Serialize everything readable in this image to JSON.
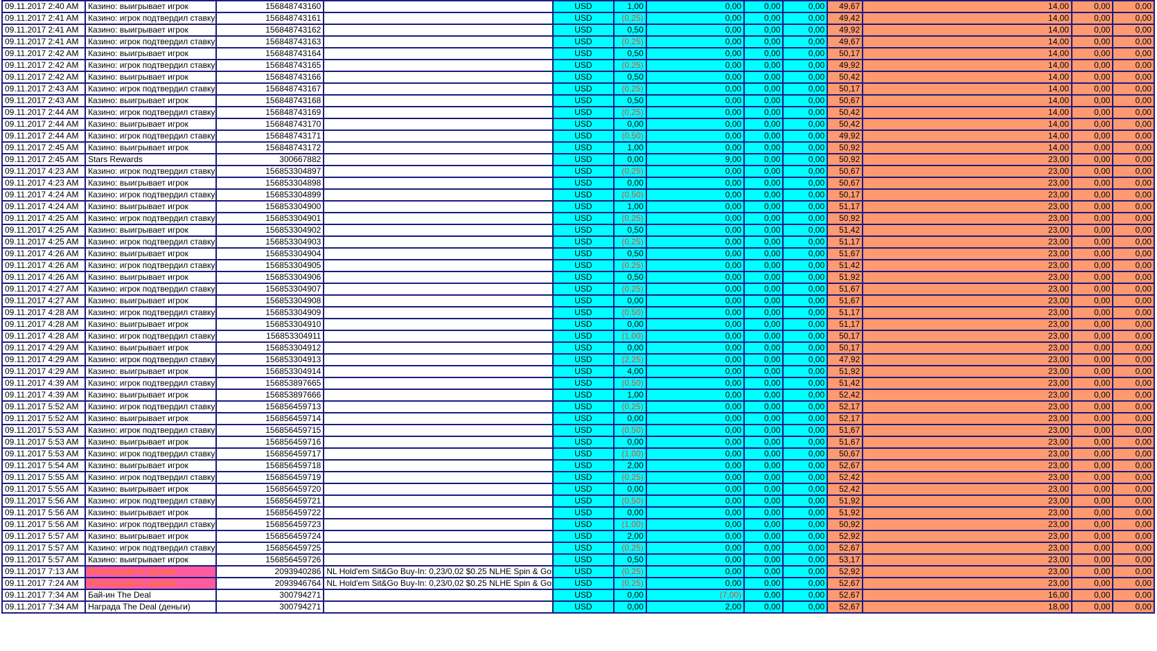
{
  "colors": {
    "border": "#1a1a80",
    "cyan": "#00ffff",
    "salmon": "#ff9a70",
    "pink": "#ff5ca0",
    "negative_text": "#e8452a"
  },
  "rows": [
    [
      "09.11.2017 2:40 AM",
      "Казино: выигрывает игрок",
      "156848743160",
      "",
      "USD",
      "1,00",
      "0,00",
      "0,00",
      "0,00",
      "49,67",
      "14,00",
      "0,00",
      "0,00"
    ],
    [
      "09.11.2017 2:41 AM",
      "Казино: игрок подтвердил ставку",
      "156848743161",
      "",
      "USD",
      "(0,25)",
      "0,00",
      "0,00",
      "0,00",
      "49,42",
      "14,00",
      "0,00",
      "0,00"
    ],
    [
      "09.11.2017 2:41 AM",
      "Казино: выигрывает игрок",
      "156848743162",
      "",
      "USD",
      "0,50",
      "0,00",
      "0,00",
      "0,00",
      "49,92",
      "14,00",
      "0,00",
      "0,00"
    ],
    [
      "09.11.2017 2:41 AM",
      "Казино: игрок подтвердил ставку",
      "156848743163",
      "",
      "USD",
      "(0,25)",
      "0,00",
      "0,00",
      "0,00",
      "49,67",
      "14,00",
      "0,00",
      "0,00"
    ],
    [
      "09.11.2017 2:42 AM",
      "Казино: выигрывает игрок",
      "156848743164",
      "",
      "USD",
      "0,50",
      "0,00",
      "0,00",
      "0,00",
      "50,17",
      "14,00",
      "0,00",
      "0,00"
    ],
    [
      "09.11.2017 2:42 AM",
      "Казино: игрок подтвердил ставку",
      "156848743165",
      "",
      "USD",
      "(0,25)",
      "0,00",
      "0,00",
      "0,00",
      "49,92",
      "14,00",
      "0,00",
      "0,00"
    ],
    [
      "09.11.2017 2:42 AM",
      "Казино: выигрывает игрок",
      "156848743166",
      "",
      "USD",
      "0,50",
      "0,00",
      "0,00",
      "0,00",
      "50,42",
      "14,00",
      "0,00",
      "0,00"
    ],
    [
      "09.11.2017 2:43 AM",
      "Казино: игрок подтвердил ставку",
      "156848743167",
      "",
      "USD",
      "(0,25)",
      "0,00",
      "0,00",
      "0,00",
      "50,17",
      "14,00",
      "0,00",
      "0,00"
    ],
    [
      "09.11.2017 2:43 AM",
      "Казино: выигрывает игрок",
      "156848743168",
      "",
      "USD",
      "0,50",
      "0,00",
      "0,00",
      "0,00",
      "50,67",
      "14,00",
      "0,00",
      "0,00"
    ],
    [
      "09.11.2017 2:44 AM",
      "Казино: игрок подтвердил ставку",
      "156848743169",
      "",
      "USD",
      "(0,25)",
      "0,00",
      "0,00",
      "0,00",
      "50,42",
      "14,00",
      "0,00",
      "0,00"
    ],
    [
      "09.11.2017 2:44 AM",
      "Казино: выигрывает игрок",
      "156848743170",
      "",
      "USD",
      "0,00",
      "0,00",
      "0,00",
      "0,00",
      "50,42",
      "14,00",
      "0,00",
      "0,00"
    ],
    [
      "09.11.2017 2:44 AM",
      "Казино: игрок подтвердил ставку",
      "156848743171",
      "",
      "USD",
      "(0,50)",
      "0,00",
      "0,00",
      "0,00",
      "49,92",
      "14,00",
      "0,00",
      "0,00"
    ],
    [
      "09.11.2017 2:45 AM",
      "Казино: выигрывает игрок",
      "156848743172",
      "",
      "USD",
      "1,00",
      "0,00",
      "0,00",
      "0,00",
      "50,92",
      "14,00",
      "0,00",
      "0,00"
    ],
    [
      "09.11.2017 2:45 AM",
      "Stars Rewards",
      "300667882",
      "",
      "USD",
      "0,00",
      "9,00",
      "0,00",
      "0,00",
      "50,92",
      "23,00",
      "0,00",
      "0,00"
    ],
    [
      "09.11.2017 4:23 AM",
      "Казино: игрок подтвердил ставку",
      "156853304897",
      "",
      "USD",
      "(0,25)",
      "0,00",
      "0,00",
      "0,00",
      "50,67",
      "23,00",
      "0,00",
      "0,00"
    ],
    [
      "09.11.2017 4:23 AM",
      "Казино: выигрывает игрок",
      "156853304898",
      "",
      "USD",
      "0,00",
      "0,00",
      "0,00",
      "0,00",
      "50,67",
      "23,00",
      "0,00",
      "0,00"
    ],
    [
      "09.11.2017 4:24 AM",
      "Казино: игрок подтвердил ставку",
      "156853304899",
      "",
      "USD",
      "(0,50)",
      "0,00",
      "0,00",
      "0,00",
      "50,17",
      "23,00",
      "0,00",
      "0,00"
    ],
    [
      "09.11.2017 4:24 AM",
      "Казино: выигрывает игрок",
      "156853304900",
      "",
      "USD",
      "1,00",
      "0,00",
      "0,00",
      "0,00",
      "51,17",
      "23,00",
      "0,00",
      "0,00"
    ],
    [
      "09.11.2017 4:25 AM",
      "Казино: игрок подтвердил ставку",
      "156853304901",
      "",
      "USD",
      "(0,25)",
      "0,00",
      "0,00",
      "0,00",
      "50,92",
      "23,00",
      "0,00",
      "0,00"
    ],
    [
      "09.11.2017 4:25 AM",
      "Казино: выигрывает игрок",
      "156853304902",
      "",
      "USD",
      "0,50",
      "0,00",
      "0,00",
      "0,00",
      "51,42",
      "23,00",
      "0,00",
      "0,00"
    ],
    [
      "09.11.2017 4:25 AM",
      "Казино: игрок подтвердил ставку",
      "156853304903",
      "",
      "USD",
      "(0,25)",
      "0,00",
      "0,00",
      "0,00",
      "51,17",
      "23,00",
      "0,00",
      "0,00"
    ],
    [
      "09.11.2017 4:26 AM",
      "Казино: выигрывает игрок",
      "156853304904",
      "",
      "USD",
      "0,50",
      "0,00",
      "0,00",
      "0,00",
      "51,67",
      "23,00",
      "0,00",
      "0,00"
    ],
    [
      "09.11.2017 4:26 AM",
      "Казино: игрок подтвердил ставку",
      "156853304905",
      "",
      "USD",
      "(0,25)",
      "0,00",
      "0,00",
      "0,00",
      "51,42",
      "23,00",
      "0,00",
      "0,00"
    ],
    [
      "09.11.2017 4:26 AM",
      "Казино: выигрывает игрок",
      "156853304906",
      "",
      "USD",
      "0,50",
      "0,00",
      "0,00",
      "0,00",
      "51,92",
      "23,00",
      "0,00",
      "0,00"
    ],
    [
      "09.11.2017 4:27 AM",
      "Казино: игрок подтвердил ставку",
      "156853304907",
      "",
      "USD",
      "(0,25)",
      "0,00",
      "0,00",
      "0,00",
      "51,67",
      "23,00",
      "0,00",
      "0,00"
    ],
    [
      "09.11.2017 4:27 AM",
      "Казино: выигрывает игрок",
      "156853304908",
      "",
      "USD",
      "0,00",
      "0,00",
      "0,00",
      "0,00",
      "51,67",
      "23,00",
      "0,00",
      "0,00"
    ],
    [
      "09.11.2017 4:28 AM",
      "Казино: игрок подтвердил ставку",
      "156853304909",
      "",
      "USD",
      "(0,50)",
      "0,00",
      "0,00",
      "0,00",
      "51,17",
      "23,00",
      "0,00",
      "0,00"
    ],
    [
      "09.11.2017 4:28 AM",
      "Казино: выигрывает игрок",
      "156853304910",
      "",
      "USD",
      "0,00",
      "0,00",
      "0,00",
      "0,00",
      "51,17",
      "23,00",
      "0,00",
      "0,00"
    ],
    [
      "09.11.2017 4:28 AM",
      "Казино: игрок подтвердил ставку",
      "156853304911",
      "",
      "USD",
      "(1,00)",
      "0,00",
      "0,00",
      "0,00",
      "50,17",
      "23,00",
      "0,00",
      "0,00"
    ],
    [
      "09.11.2017 4:29 AM",
      "Казино: выигрывает игрок",
      "156853304912",
      "",
      "USD",
      "0,00",
      "0,00",
      "0,00",
      "0,00",
      "50,17",
      "23,00",
      "0,00",
      "0,00"
    ],
    [
      "09.11.2017 4:29 AM",
      "Казино: игрок подтвердил ставку",
      "156853304913",
      "",
      "USD",
      "(2,25)",
      "0,00",
      "0,00",
      "0,00",
      "47,92",
      "23,00",
      "0,00",
      "0,00"
    ],
    [
      "09.11.2017 4:29 AM",
      "Казино: выигрывает игрок",
      "156853304914",
      "",
      "USD",
      "4,00",
      "0,00",
      "0,00",
      "0,00",
      "51,92",
      "23,00",
      "0,00",
      "0,00"
    ],
    [
      "09.11.2017 4:39 AM",
      "Казино: игрок подтвердил ставку",
      "156853897665",
      "",
      "USD",
      "(0,50)",
      "0,00",
      "0,00",
      "0,00",
      "51,42",
      "23,00",
      "0,00",
      "0,00"
    ],
    [
      "09.11.2017 4:39 AM",
      "Казино: выигрывает игрок",
      "156853897666",
      "",
      "USD",
      "1,00",
      "0,00",
      "0,00",
      "0,00",
      "52,42",
      "23,00",
      "0,00",
      "0,00"
    ],
    [
      "09.11.2017 5:52 AM",
      "Казино: игрок подтвердил ставку",
      "156856459713",
      "",
      "USD",
      "(0,25)",
      "0,00",
      "0,00",
      "0,00",
      "52,17",
      "23,00",
      "0,00",
      "0,00"
    ],
    [
      "09.11.2017 5:52 AM",
      "Казино: выигрывает игрок",
      "156856459714",
      "",
      "USD",
      "0,00",
      "0,00",
      "0,00",
      "0,00",
      "52,17",
      "23,00",
      "0,00",
      "0,00"
    ],
    [
      "09.11.2017 5:53 AM",
      "Казино: игрок подтвердил ставку",
      "156856459715",
      "",
      "USD",
      "(0,50)",
      "0,00",
      "0,00",
      "0,00",
      "51,67",
      "23,00",
      "0,00",
      "0,00"
    ],
    [
      "09.11.2017 5:53 AM",
      "Казино: выигрывает игрок",
      "156856459716",
      "",
      "USD",
      "0,00",
      "0,00",
      "0,00",
      "0,00",
      "51,67",
      "23,00",
      "0,00",
      "0,00"
    ],
    [
      "09.11.2017 5:53 AM",
      "Казино: игрок подтвердил ставку",
      "156856459717",
      "",
      "USD",
      "(1,00)",
      "0,00",
      "0,00",
      "0,00",
      "50,67",
      "23,00",
      "0,00",
      "0,00"
    ],
    [
      "09.11.2017 5:54 AM",
      "Казино: выигрывает игрок",
      "156856459718",
      "",
      "USD",
      "2,00",
      "0,00",
      "0,00",
      "0,00",
      "52,67",
      "23,00",
      "0,00",
      "0,00"
    ],
    [
      "09.11.2017 5:55 AM",
      "Казино: игрок подтвердил ставку",
      "156856459719",
      "",
      "USD",
      "(0,25)",
      "0,00",
      "0,00",
      "0,00",
      "52,42",
      "23,00",
      "0,00",
      "0,00"
    ],
    [
      "09.11.2017 5:55 AM",
      "Казино: выигрывает игрок",
      "156856459720",
      "",
      "USD",
      "0,00",
      "0,00",
      "0,00",
      "0,00",
      "52,42",
      "23,00",
      "0,00",
      "0,00"
    ],
    [
      "09.11.2017 5:56 AM",
      "Казино: игрок подтвердил ставку",
      "156856459721",
      "",
      "USD",
      "(0,50)",
      "0,00",
      "0,00",
      "0,00",
      "51,92",
      "23,00",
      "0,00",
      "0,00"
    ],
    [
      "09.11.2017 5:56 AM",
      "Казино: выигрывает игрок",
      "156856459722",
      "",
      "USD",
      "0,00",
      "0,00",
      "0,00",
      "0,00",
      "51,92",
      "23,00",
      "0,00",
      "0,00"
    ],
    [
      "09.11.2017 5:56 AM",
      "Казино: игрок подтвердил ставку",
      "156856459723",
      "",
      "USD",
      "(1,00)",
      "0,00",
      "0,00",
      "0,00",
      "50,92",
      "23,00",
      "0,00",
      "0,00"
    ],
    [
      "09.11.2017 5:57 AM",
      "Казино: выигрывает игрок",
      "156856459724",
      "",
      "USD",
      "2,00",
      "0,00",
      "0,00",
      "0,00",
      "52,92",
      "23,00",
      "0,00",
      "0,00"
    ],
    [
      "09.11.2017 5:57 AM",
      "Казино: игрок подтвердил ставку",
      "156856459725",
      "",
      "USD",
      "(0,25)",
      "0,00",
      "0,00",
      "0,00",
      "52,67",
      "23,00",
      "0,00",
      "0,00"
    ],
    [
      "09.11.2017 5:57 AM",
      "Казино: выигрывает игрок",
      "156856459726",
      "",
      "USD",
      "0,50",
      "0,00",
      "0,00",
      "0,00",
      "53,17",
      "23,00",
      "0,00",
      "0,00"
    ],
    [
      "09.11.2017 7:13 AM",
      "Регистрация в турнире",
      "2093940286",
      "NL Hold'em Sit&Go Buy-In: 0,23/0,02 $0.25 NLHE Spin & Go",
      "USD",
      "(0,25)",
      "0,00",
      "0,00",
      "0,00",
      "52,92",
      "23,00",
      "0,00",
      "0,00"
    ],
    [
      "09.11.2017 7:24 AM",
      "Регистрация в турнире",
      "2093946764",
      "NL Hold'em Sit&Go Buy-In: 0,23/0,02 $0.25 NLHE Spin & Go",
      "USD",
      "(0,25)",
      "0,00",
      "0,00",
      "0,00",
      "52,67",
      "23,00",
      "0,00",
      "0,00"
    ],
    [
      "09.11.2017 7:34 AM",
      "Бай-ин The Deal",
      "300794271",
      "",
      "USD",
      "0,00",
      "(7,00)",
      "0,00",
      "0,00",
      "52,67",
      "16,00",
      "0,00",
      "0,00"
    ],
    [
      "09.11.2017 7:34 AM",
      "Награда The Deal (деньги)",
      "300794271",
      "",
      "USD",
      "0,00",
      "2,00",
      "0,00",
      "0,00",
      "52,67",
      "18,00",
      "0,00",
      "0,00"
    ]
  ],
  "highlighted_rows": [
    48,
    49
  ]
}
